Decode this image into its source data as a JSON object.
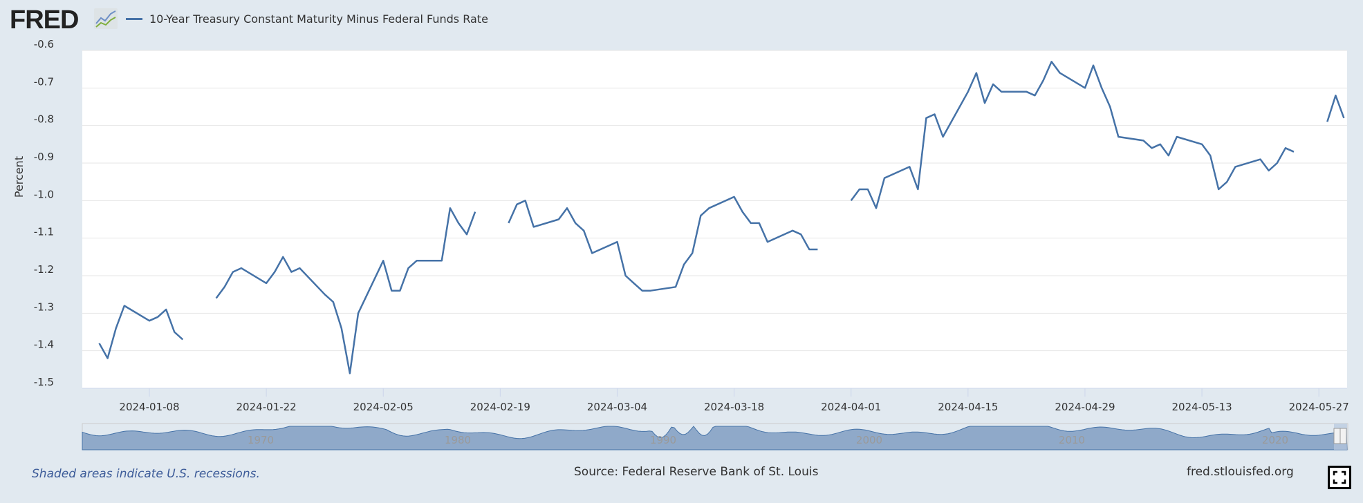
{
  "header": {
    "logo": "FRED",
    "series_title": "10-Year Treasury Constant Maturity Minus Federal Funds Rate"
  },
  "chart_data": {
    "type": "line",
    "title": "10-Year Treasury Constant Maturity Minus Federal Funds Rate",
    "ylabel": "Percent",
    "xlabel": "",
    "ylim": [
      -1.5,
      -0.6
    ],
    "yticks": [
      "-0.6",
      "-0.7",
      "-0.8",
      "-0.9",
      "-1.0",
      "-1.1",
      "-1.2",
      "-1.3",
      "-1.4",
      "-1.5"
    ],
    "xticks": [
      "2024-01-08",
      "2024-01-22",
      "2024-02-05",
      "2024-02-19",
      "2024-03-04",
      "2024-03-18",
      "2024-04-01",
      "2024-04-15",
      "2024-04-29",
      "2024-05-13",
      "2024-05-27"
    ],
    "xlim": [
      "2024-01-02",
      "2024-05-30"
    ],
    "grid": true,
    "color": "#4572a7",
    "series": [
      {
        "name": "10-Year Treasury Constant Maturity Minus Federal Funds Rate",
        "x": [
          "2024-01-02",
          "2024-01-03",
          "2024-01-04",
          "2024-01-05",
          "2024-01-08",
          "2024-01-09",
          "2024-01-10",
          "2024-01-11",
          "2024-01-12",
          "2024-01-15",
          "2024-01-16",
          "2024-01-17",
          "2024-01-18",
          "2024-01-19",
          "2024-01-22",
          "2024-01-23",
          "2024-01-24",
          "2024-01-25",
          "2024-01-26",
          "2024-01-29",
          "2024-01-30",
          "2024-01-31",
          "2024-02-01",
          "2024-02-02",
          "2024-02-05",
          "2024-02-06",
          "2024-02-07",
          "2024-02-08",
          "2024-02-09",
          "2024-02-12",
          "2024-02-13",
          "2024-02-14",
          "2024-02-15",
          "2024-02-16",
          "2024-02-19",
          "2024-02-20",
          "2024-02-21",
          "2024-02-22",
          "2024-02-23",
          "2024-02-26",
          "2024-02-27",
          "2024-02-28",
          "2024-02-29",
          "2024-03-01",
          "2024-03-04",
          "2024-03-05",
          "2024-03-06",
          "2024-03-07",
          "2024-03-08",
          "2024-03-11",
          "2024-03-12",
          "2024-03-13",
          "2024-03-14",
          "2024-03-15",
          "2024-03-18",
          "2024-03-19",
          "2024-03-20",
          "2024-03-21",
          "2024-03-22",
          "2024-03-25",
          "2024-03-26",
          "2024-03-27",
          "2024-03-28",
          "2024-03-29",
          "2024-04-01",
          "2024-04-02",
          "2024-04-03",
          "2024-04-04",
          "2024-04-05",
          "2024-04-08",
          "2024-04-09",
          "2024-04-10",
          "2024-04-11",
          "2024-04-12",
          "2024-04-15",
          "2024-04-16",
          "2024-04-17",
          "2024-04-18",
          "2024-04-19",
          "2024-04-22",
          "2024-04-23",
          "2024-04-24",
          "2024-04-25",
          "2024-04-26",
          "2024-04-29",
          "2024-04-30",
          "2024-05-01",
          "2024-05-02",
          "2024-05-03",
          "2024-05-06",
          "2024-05-07",
          "2024-05-08",
          "2024-05-09",
          "2024-05-10",
          "2024-05-13",
          "2024-05-14",
          "2024-05-15",
          "2024-05-16",
          "2024-05-17",
          "2024-05-20",
          "2024-05-21",
          "2024-05-22",
          "2024-05-23",
          "2024-05-24",
          "2024-05-27",
          "2024-05-28",
          "2024-05-29",
          "2024-05-30"
        ],
        "values": [
          -1.38,
          -1.42,
          -1.34,
          -1.28,
          -1.32,
          -1.31,
          -1.29,
          -1.35,
          -1.37,
          null,
          -1.26,
          -1.23,
          -1.19,
          -1.18,
          -1.22,
          -1.19,
          -1.15,
          -1.19,
          -1.18,
          -1.25,
          -1.27,
          -1.34,
          -1.46,
          -1.3,
          -1.16,
          -1.24,
          -1.24,
          -1.18,
          -1.16,
          -1.16,
          -1.02,
          -1.06,
          -1.09,
          -1.03,
          null,
          -1.06,
          -1.01,
          -1.0,
          -1.07,
          -1.05,
          -1.02,
          -1.06,
          -1.08,
          -1.14,
          -1.11,
          -1.2,
          -1.22,
          -1.24,
          -1.24,
          -1.23,
          -1.17,
          -1.14,
          -1.04,
          -1.02,
          -0.99,
          -1.03,
          -1.06,
          -1.06,
          -1.11,
          -1.08,
          -1.09,
          -1.13,
          -1.13,
          null,
          -1.0,
          -0.97,
          -0.97,
          -1.02,
          -0.94,
          -0.91,
          -0.97,
          -0.78,
          -0.77,
          -0.83,
          -0.71,
          -0.66,
          -0.74,
          -0.69,
          -0.71,
          -0.71,
          -0.72,
          -0.68,
          -0.63,
          -0.66,
          -0.7,
          -0.64,
          -0.7,
          -0.75,
          -0.83,
          -0.84,
          -0.86,
          -0.85,
          -0.88,
          -0.83,
          -0.85,
          -0.88,
          -0.97,
          -0.95,
          -0.91,
          -0.89,
          -0.92,
          -0.9,
          -0.86,
          -0.87,
          null,
          -0.79,
          -0.72,
          -0.78
        ]
      }
    ]
  },
  "navigator": {
    "year_labels": [
      "1970",
      "1980",
      "1990",
      "2000",
      "2010",
      "2020"
    ]
  },
  "footer": {
    "recession_note": "Shaded areas indicate U.S. recessions.",
    "source": "Source: Federal Reserve Bank of St. Louis",
    "site": "fred.stlouisfed.org"
  }
}
